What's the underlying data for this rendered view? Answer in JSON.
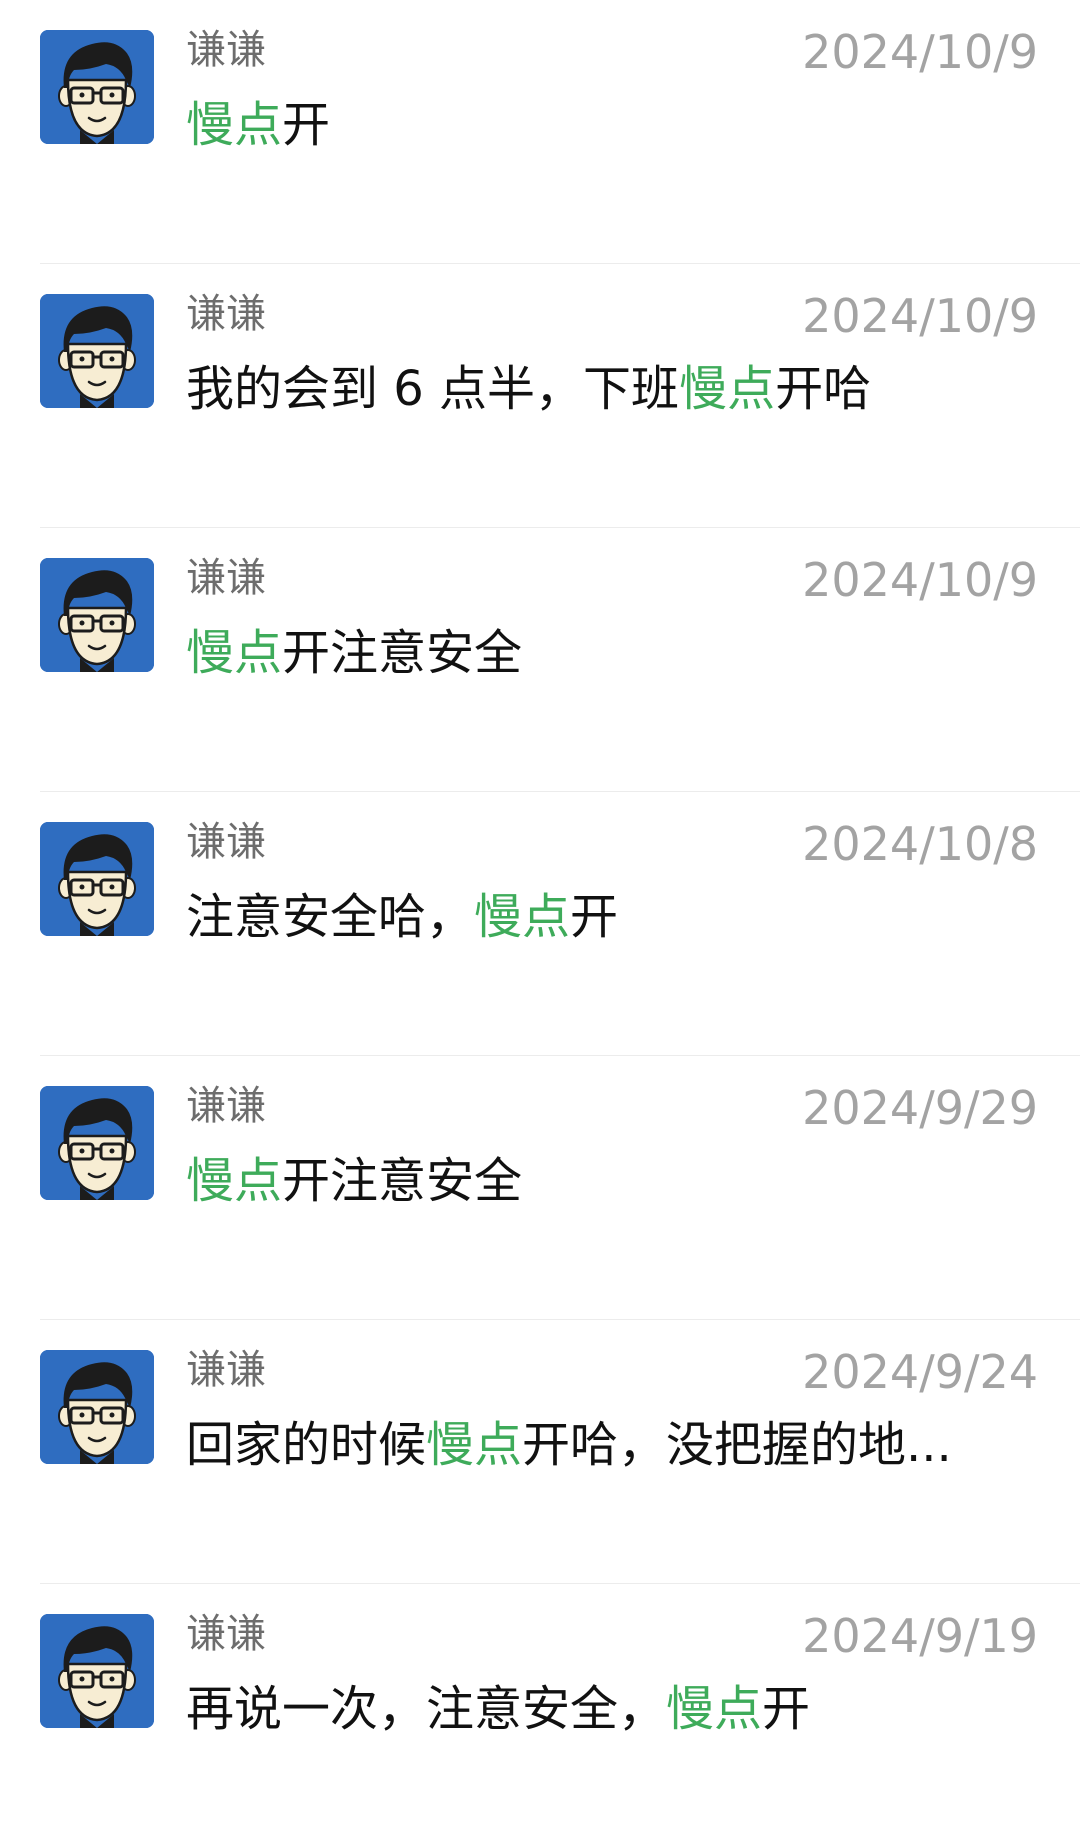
{
  "colors": {
    "highlight": "#3eab5a",
    "avatar_bg": "#2f6dc0",
    "date": "#a3a3a3",
    "sender": "#6d6d6d",
    "divider": "#ececec"
  },
  "results": [
    {
      "avatar_icon": "cartoon-man-glasses-icon",
      "sender": "谦谦",
      "date": "2024/10/9",
      "message": [
        {
          "text": "慢点",
          "highlight": true
        },
        {
          "text": "开",
          "highlight": false
        }
      ]
    },
    {
      "avatar_icon": "cartoon-man-glasses-icon",
      "sender": "谦谦",
      "date": "2024/10/9",
      "message": [
        {
          "text": "我的会到 6 点半，下班",
          "highlight": false
        },
        {
          "text": "慢点",
          "highlight": true
        },
        {
          "text": "开哈",
          "highlight": false
        }
      ]
    },
    {
      "avatar_icon": "cartoon-man-glasses-icon",
      "sender": "谦谦",
      "date": "2024/10/9",
      "message": [
        {
          "text": "慢点",
          "highlight": true
        },
        {
          "text": "开注意安全",
          "highlight": false
        }
      ]
    },
    {
      "avatar_icon": "cartoon-man-glasses-icon",
      "sender": "谦谦",
      "date": "2024/10/8",
      "message": [
        {
          "text": "注意安全哈，",
          "highlight": false
        },
        {
          "text": "慢点",
          "highlight": true
        },
        {
          "text": "开",
          "highlight": false
        }
      ]
    },
    {
      "avatar_icon": "cartoon-man-glasses-icon",
      "sender": "谦谦",
      "date": "2024/9/29",
      "message": [
        {
          "text": "慢点",
          "highlight": true
        },
        {
          "text": "开注意安全",
          "highlight": false
        }
      ]
    },
    {
      "avatar_icon": "cartoon-man-glasses-icon",
      "sender": "谦谦",
      "date": "2024/9/24",
      "message": [
        {
          "text": "回家的时候",
          "highlight": false
        },
        {
          "text": "慢点",
          "highlight": true
        },
        {
          "text": "开哈，没把握的地...",
          "highlight": false
        }
      ]
    },
    {
      "avatar_icon": "cartoon-man-glasses-icon",
      "sender": "谦谦",
      "date": "2024/9/19",
      "message": [
        {
          "text": "再说一次，注意安全，",
          "highlight": false
        },
        {
          "text": "慢点",
          "highlight": true
        },
        {
          "text": "开",
          "highlight": false
        }
      ]
    }
  ]
}
